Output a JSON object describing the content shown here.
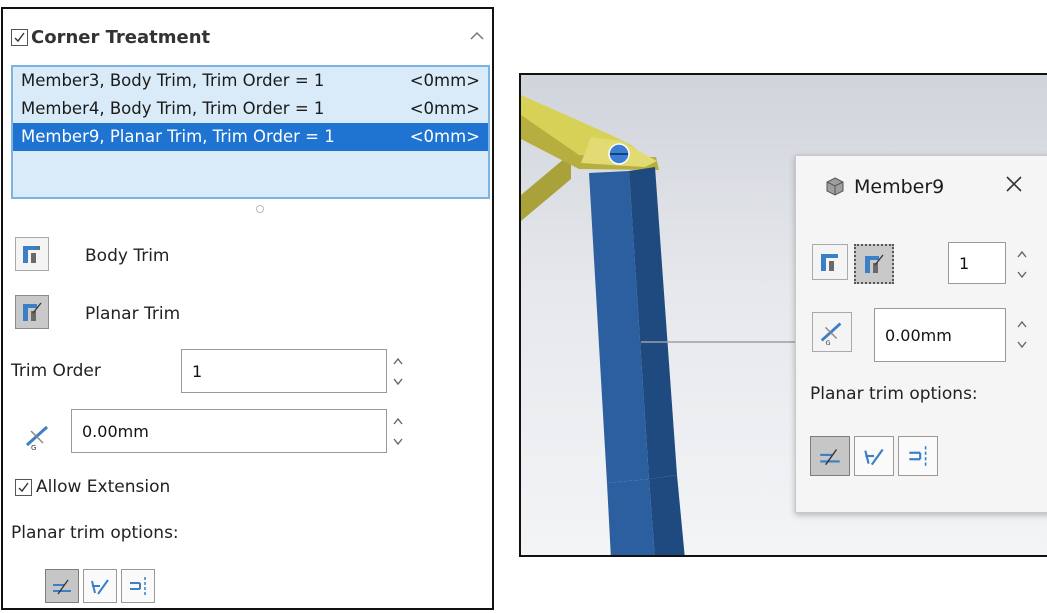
{
  "corner_treatment": {
    "title": "Corner Treatment",
    "checked": true,
    "items": [
      {
        "name": "Member3, Body Trim, Trim Order = 1",
        "value": "<0mm>",
        "selected": false
      },
      {
        "name": "Member4, Body Trim, Trim Order = 1",
        "value": "<0mm>",
        "selected": false
      },
      {
        "name": "Member9, Planar Trim, Trim Order = 1",
        "value": "<0mm>",
        "selected": true
      }
    ]
  },
  "trim_types": {
    "body_trim": "Body Trim",
    "planar_trim": "Planar Trim",
    "active": "planar_trim"
  },
  "trim_order": {
    "label": "Trim Order",
    "value": "1"
  },
  "gap": {
    "value": "0.00mm"
  },
  "allow_extension": {
    "label": "Allow Extension",
    "checked": true
  },
  "planar_trim_options": {
    "label": "Planar trim options:",
    "active_index": 0
  },
  "popup": {
    "title": "Member9",
    "trim_order_value": "1",
    "gap_value": "0.00mm",
    "planar_label": "Planar trim options:"
  },
  "colors": {
    "selection_blue": "#1e74d0",
    "list_background": "#d9ebf8",
    "beam_blue": "#2d5e9c",
    "beam_yellow": "#c9c24a"
  },
  "icons": [
    "check-icon",
    "chevron-up-icon",
    "body-trim-icon",
    "planar-trim-icon",
    "gap-icon",
    "spin-up-icon",
    "spin-down-icon",
    "trim-option-icon",
    "close-icon",
    "cube-icon"
  ]
}
